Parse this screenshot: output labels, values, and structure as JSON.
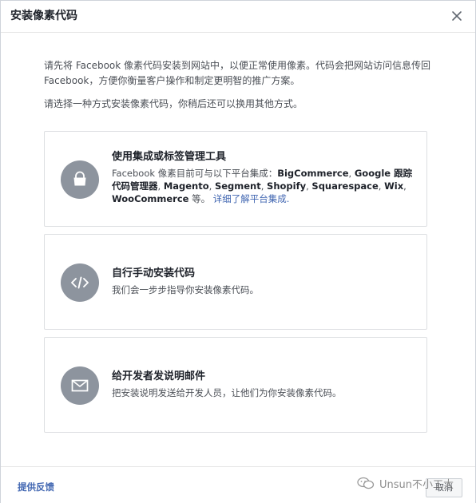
{
  "dialog": {
    "title": "安装像素代码",
    "close_icon": "close-icon"
  },
  "intro": {
    "paragraph1": "请先将 Facebook 像素代码安装到网站中，以便正常使用像素。代码会把网站访问信息传回 Facebook，方便你衡量客户操作和制定更明智的推广方案。",
    "paragraph2": "请选择一种方式安装像素代码，你稍后还可以换用其他方式。"
  },
  "options": [
    {
      "title": "使用集成或标签管理工具",
      "icon": "shopping-bag-icon",
      "desc_prefix": "Facebook 像素目前可与以下平台集成：",
      "platforms": [
        "BigCommerce",
        "Google 跟踪代码管理器",
        "Magento",
        "Segment",
        "Shopify",
        "Squarespace",
        "Wix",
        "WooCommerce"
      ],
      "desc_suffix": " 等。",
      "link": "详细了解平台集成."
    },
    {
      "title": "自行手动安装代码",
      "icon": "code-icon",
      "desc": "我们会一步步指导你安装像素代码。"
    },
    {
      "title": "给开发者发说明邮件",
      "icon": "envelope-icon",
      "desc": "把安装说明发送给开发人员，让他们为你安装像素代码。"
    }
  ],
  "footer": {
    "feedback": "提供反馈",
    "button": "取消"
  },
  "watermark": {
    "text": "Unsun不小工大",
    "icon": "wechat-icon"
  },
  "colors": {
    "accent": "#4267b2",
    "icon_circle": "#8d949e",
    "border": "#dddfe2"
  }
}
